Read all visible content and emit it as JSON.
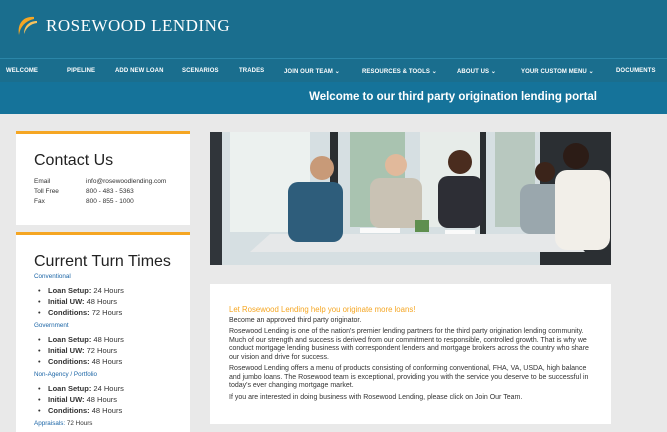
{
  "brand": {
    "name": "ROSEWOOD LENDING",
    "logo_icon": "rosewood-swoosh-icon"
  },
  "nav": [
    {
      "label": "WELCOME"
    },
    {
      "label": "PIPELINE"
    },
    {
      "label": "ADD NEW LOAN"
    },
    {
      "label": "SCENARIOS"
    },
    {
      "label": "TRADES"
    },
    {
      "label": "JOIN OUR TEAM ⌄"
    },
    {
      "label": "RESOURCES & TOOLS ⌄"
    },
    {
      "label": "ABOUT US ⌄"
    },
    {
      "label": "YOUR CUSTOM MENU ⌄"
    },
    {
      "label": "DOCUMENTS"
    }
  ],
  "banner": {
    "text": "Welcome to our third party origination lending portal"
  },
  "contact": {
    "title": "Contact Us",
    "rows": [
      {
        "k": "Email",
        "v": "info@rosewoodlending.com"
      },
      {
        "k": "Toll Free",
        "v": "800 - 483 - 5363"
      },
      {
        "k": "Fax",
        "v": "800 - 855 - 1000"
      }
    ]
  },
  "turn": {
    "title": "Current Turn Times",
    "sections": [
      {
        "name": "Conventional",
        "items": [
          {
            "label": "Loan Setup:",
            "val": " 24 Hours"
          },
          {
            "label": "Initial UW:",
            "val": " 48 Hours"
          },
          {
            "label": "Conditions:",
            "val": " 72 Hours"
          }
        ]
      },
      {
        "name": "Government",
        "items": [
          {
            "label": "Loan Setup:",
            "val": " 48 Hours"
          },
          {
            "label": "Initial UW:",
            "val": " 72 Hours"
          },
          {
            "label": "Conditions:",
            "val": " 48 Hours"
          }
        ]
      },
      {
        "name": "Non-Agency / Portfolio",
        "items": [
          {
            "label": "Loan Setup:",
            "val": " 24 Hours"
          },
          {
            "label": "Initial UW:",
            "val": " 48 Hours"
          },
          {
            "label": "Conditions:",
            "val": " 48 Hours"
          }
        ]
      }
    ],
    "appraisals": "Appraisals:",
    "appraisals_val": " 72 Hours"
  },
  "main": {
    "title": "Let Rosewood Lending help you originate more loans!",
    "p1": "Become an approved third party originator.",
    "p2": "Rosewood Lending is one of the nation's premier lending partners for the third party origination lending community. Much of our strength and success is derived from our commitment to responsible, controlled growth. That is why we conduct mortgage lending business with correspondent lenders and mortgage brokers across the country who share our vision and drive for success.",
    "p3": "Rosewood Lending offers a menu of products consisting of conforming conventional, FHA, VA, USDA, high balance and jumbo loans. The Rosewood team is exceptional, providing you with the service you deserve to be successful in today's ever changing mortgage market.",
    "p4": "If you are interested in doing business with Rosewood Lending, please click on Join Our Team."
  }
}
